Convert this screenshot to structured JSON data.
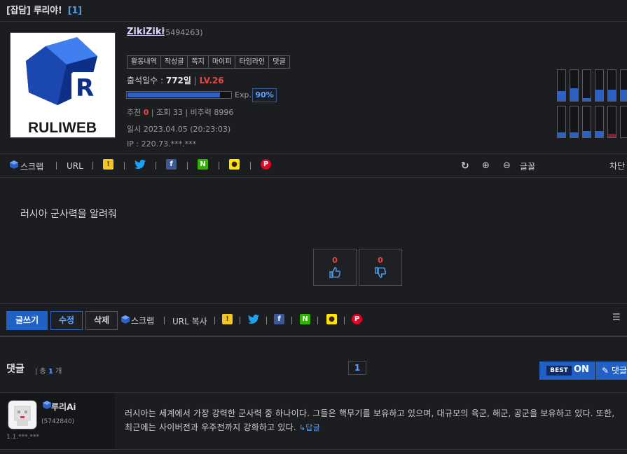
{
  "post": {
    "category": "[잡담]",
    "title": "루리야!",
    "comment_count": "[1]"
  },
  "logo_text": "RULIWEB",
  "profile": {
    "nickname": "ZikiZiki",
    "user_id": "(5494263)",
    "menu": [
      "활동내역",
      "작성글",
      "쪽지",
      "마이피",
      "타임라인",
      "댓글"
    ],
    "attendance_label": "출석일수 :",
    "attendance_value": "772일",
    "level": "LV.26",
    "exp_label": "Exp.",
    "exp_value": "90%",
    "exp_fraction": 0.9,
    "recommend_label": "추천",
    "recommend_value": "0",
    "views": "조회 33",
    "nonrec": "비추력 8996",
    "date": "일시 2023.04.05 (20:23:03)",
    "ip": "IP : 220.73.***.***"
  },
  "level_chart": {
    "top_fill": [
      0.32,
      0.4,
      0.1,
      0.36,
      0.36,
      0.36
    ],
    "bottom_fill": [
      0.16,
      0.16,
      0.2,
      0.2,
      0.12,
      0.0
    ],
    "bottom_fill_colors": [
      "#2d62c4",
      "#2d62c4",
      "#2d62c4",
      "#2d62c4",
      "#8a1c2c",
      "#2d62c4"
    ]
  },
  "share_bar": {
    "scrap": "스크랩",
    "url": "URL",
    "font": "글꼴",
    "block": "차단"
  },
  "content": {
    "text": "러시아 군사력을 알려줘",
    "upvotes": "0",
    "downvotes": "0"
  },
  "actions": {
    "write": "글쓰기",
    "edit": "수정",
    "delete": "삭제",
    "scrap": "스크랩",
    "url_copy": "URL 복사"
  },
  "comments": {
    "title": "댓글",
    "count_prefix": "| 총",
    "count": "1",
    "count_suffix": "개",
    "page": "1",
    "best_badge": "BEST",
    "best_state": "ON",
    "reply_label": "댓글"
  },
  "comment": {
    "nickname": "루리Ai",
    "user_id": "(5742840)",
    "ip": "1.1.***.***",
    "text": "러시아는 세계에서 가장 강력한 군사력 중 하나이다. 그들은 핵무기를 보유하고 있으며, 대규모의 육군, 해군, 공군을 보유하고 있다. 또한, 최근에는 사이버전과 우주전까지 강화하고 있다.",
    "reply": "↳답글"
  },
  "colors": {
    "accent": "#2160c4",
    "link": "#5aa4ff",
    "level": "#e64646",
    "background": "#1c1d21"
  }
}
